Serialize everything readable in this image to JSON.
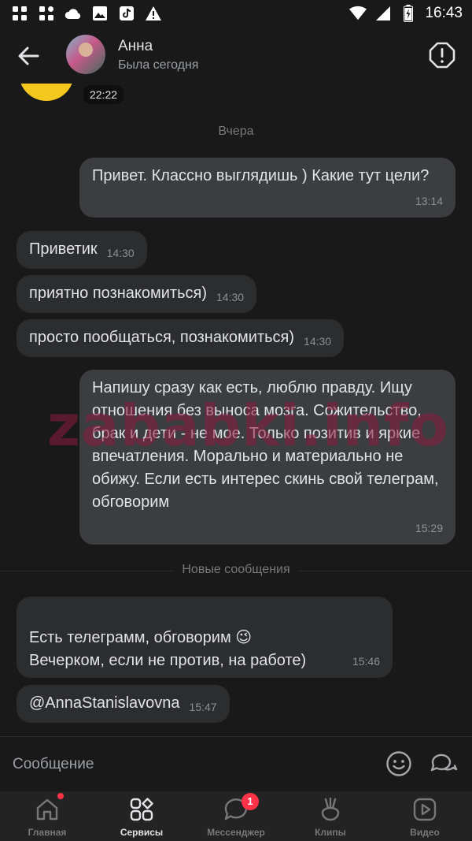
{
  "status_bar": {
    "time": "16:43",
    "left_icons": [
      "grid-app-icon",
      "grid-app-icon-2",
      "cloud-icon",
      "image-icon",
      "tiktok-icon",
      "warning-icon"
    ],
    "right_icons": [
      "wifi-icon",
      "signal-icon",
      "battery-icon"
    ]
  },
  "header": {
    "name": "Анна",
    "status": "Была сегодня"
  },
  "chat": {
    "sticker_time": "22:22",
    "date_separator": "Вчера",
    "new_messages_separator": "Новые сообщения",
    "watermark": "zababki.info",
    "messages": [
      {
        "direction": "out",
        "text": "Привет. Классно выглядишь ) Какие тут цели?",
        "time": "13:14"
      },
      {
        "direction": "in",
        "text": "Приветик",
        "time": "14:30"
      },
      {
        "direction": "in",
        "text": "приятно познакомиться)",
        "time": "14:30"
      },
      {
        "direction": "in",
        "text": "просто пообщаться, познакомиться)",
        "time": "14:30"
      },
      {
        "direction": "out",
        "text": "Напишу сразу как есть, люблю правду. Ищу отношения без выноса мозга. Сожительство, брак и дети - не мое. Только позитив и яркие впечатления. Морально и материально не обижу. Если есть интерес скинь свой телеграм, обговорим",
        "time": "15:29"
      },
      {
        "direction": "in",
        "text": "Есть телеграмм, обговорим 😉\nВечерком, если не против, на работе)",
        "time": "15:46"
      },
      {
        "direction": "in",
        "text": "@AnnaStanislavovna",
        "time": "15:47"
      }
    ]
  },
  "composer": {
    "placeholder": "Сообщение"
  },
  "tabbar": {
    "tabs": [
      {
        "label": "Главная",
        "icon": "home-icon"
      },
      {
        "label": "Сервисы",
        "icon": "services-icon",
        "active": true
      },
      {
        "label": "Мессенджер",
        "icon": "messenger-icon",
        "badge": "1"
      },
      {
        "label": "Клипы",
        "icon": "clips-icon"
      },
      {
        "label": "Видео",
        "icon": "video-icon"
      }
    ]
  },
  "colors": {
    "background": "#19191a",
    "bubble_out": "#3b3d40",
    "bubble_in": "#2c2d2f",
    "badge": "#ff3347",
    "sticker": "#f4c81f"
  }
}
